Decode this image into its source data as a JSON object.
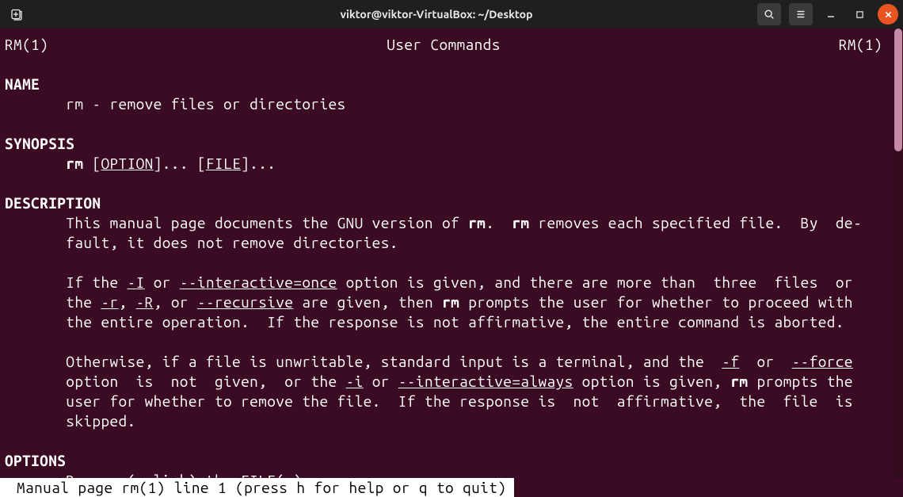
{
  "titlebar": {
    "title": "viktor@viktor-VirtualBox: ~/Desktop"
  },
  "header": {
    "left": "RM(1)",
    "center": "User Commands",
    "right": "RM(1)"
  },
  "sections": {
    "name_heading": "NAME",
    "name_text": "       rm - remove files or directories",
    "synopsis_heading": "SYNOPSIS",
    "synopsis_cmd": "rm",
    "synopsis_option": "OPTION",
    "synopsis_file": "FILE",
    "description_heading": "DESCRIPTION",
    "desc_p1a": "       This manual page documents the GNU version of ",
    "desc_rm": "rm",
    "desc_p1b": ".  ",
    "desc_p1c": " removes each specified file.  By  de‐",
    "desc_p1d": "       fault, it does not remove directories.",
    "desc_p2a": "       If the ",
    "desc_I": "-I",
    "desc_or": " or ",
    "desc_interactive_once": "--interactive=once",
    "desc_p2b": " option is given, and there are more than  three  files  or",
    "desc_p2c": "       the ",
    "desc_r": "-r",
    "comma": ", ",
    "desc_R": "-R",
    "desc_p2d": ", or ",
    "desc_recursive": "--recursive",
    "desc_p2e": " are given, then ",
    "desc_p2f": " prompts the user for whether to proceed with",
    "desc_p2g": "       the entire operation.  If the response is not affirmative, the entire command is aborted.",
    "desc_p3a": "       Otherwise, if a file is unwritable, standard input is a terminal, and the  ",
    "desc_f": "-f",
    "desc_p3b": "  or  ",
    "desc_force": "--force",
    "desc_p3c": "       option  is  not  given,  or the ",
    "desc_i": "-i",
    "desc_p3d": " or ",
    "desc_interactive_always": "--interactive=always",
    "desc_p3e": " option is given, ",
    "desc_p3f": " prompts the",
    "desc_p3g": "       user for whether to remove the file.  If the response is  not  affirmative,  the  file  is",
    "desc_p3h": "       skipped.",
    "options_heading": "OPTIONS",
    "options_text": "       Remove (unlink) the FILE(s)."
  },
  "status": " Manual page rm(1) line 1 (press h for help or q to quit)"
}
